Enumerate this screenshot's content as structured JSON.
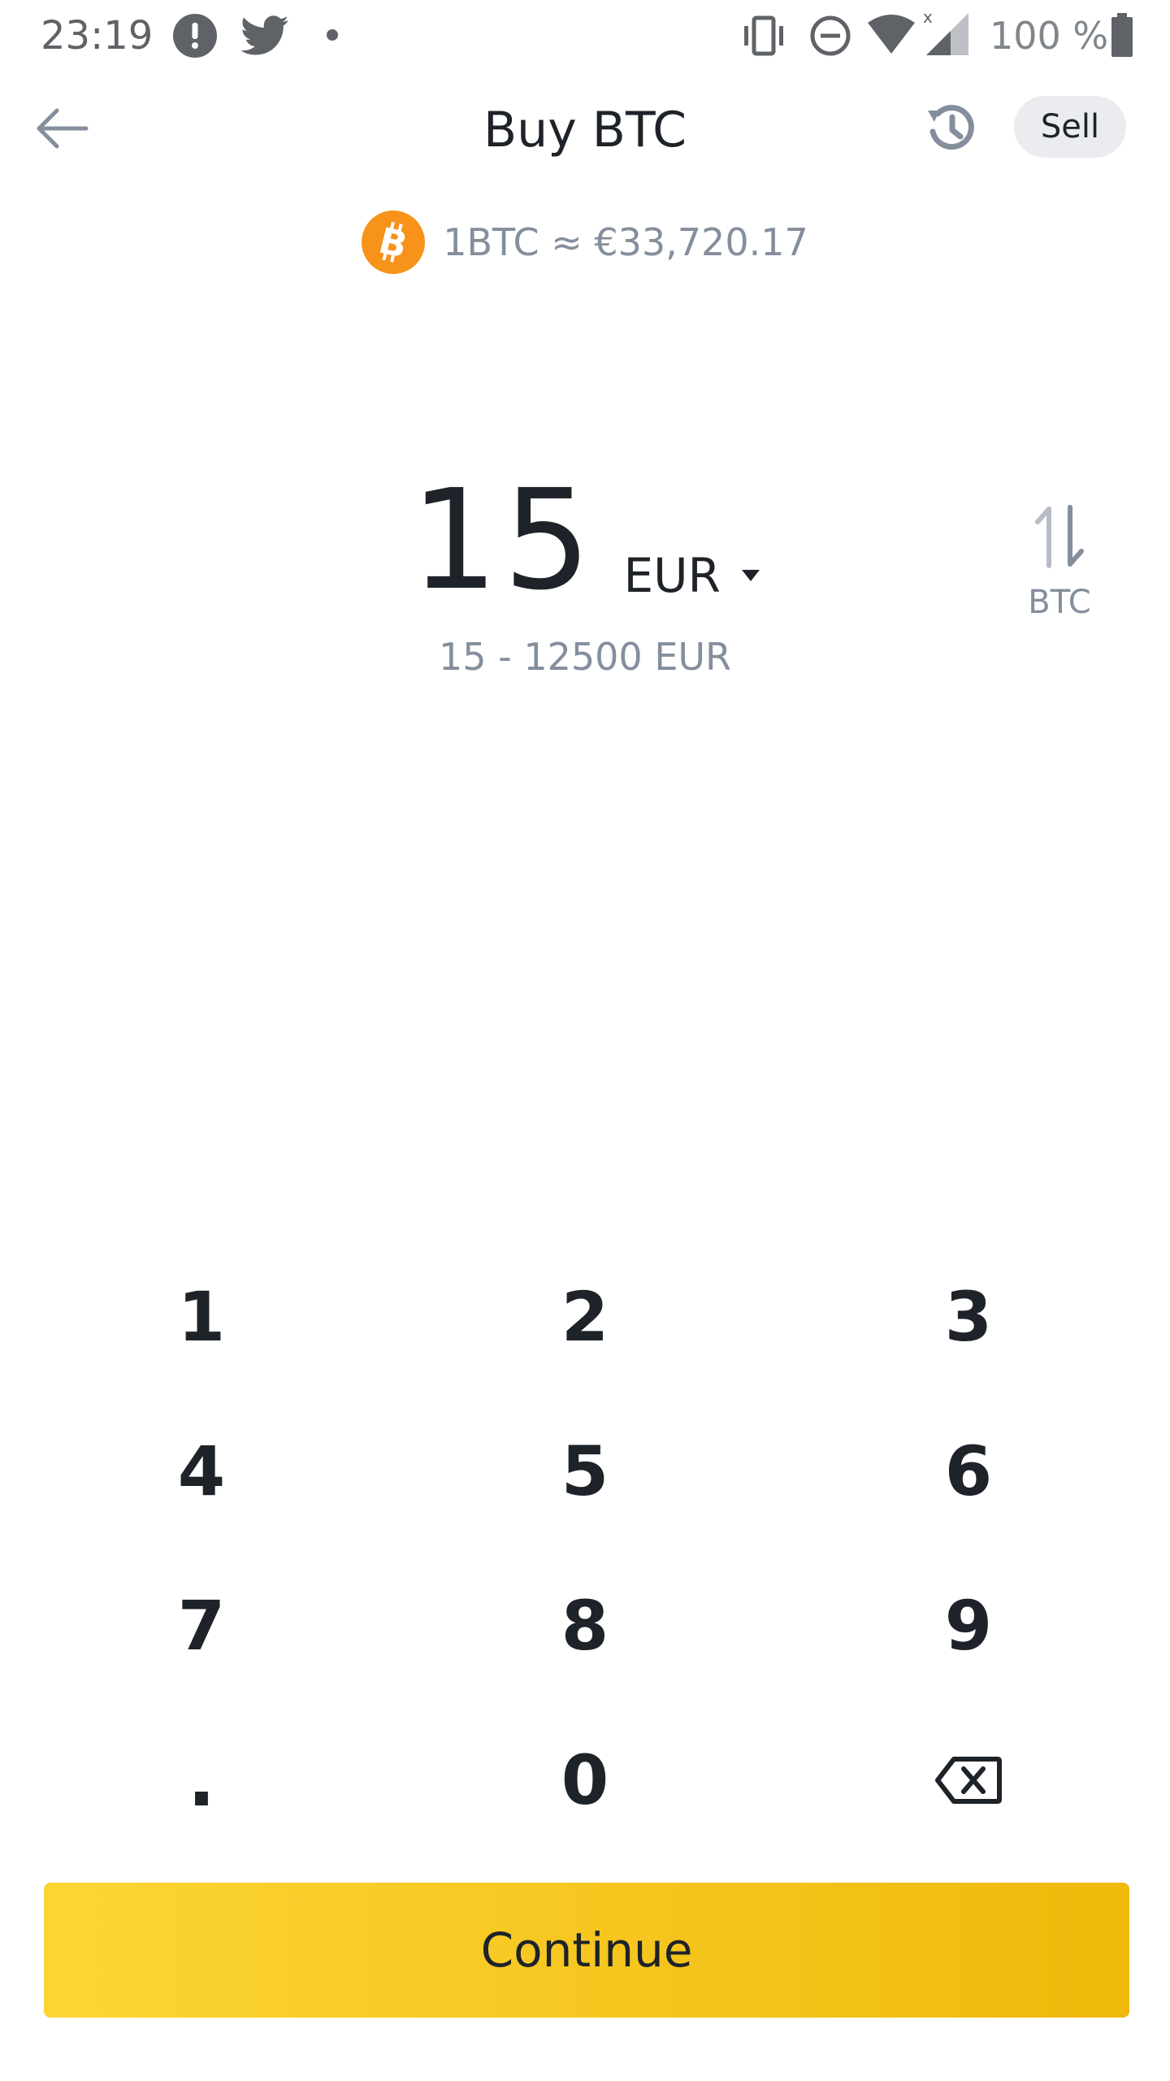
{
  "status_bar": {
    "time": "23:19",
    "battery_text": "100 %",
    "icons": [
      "alert-icon",
      "twitter-icon",
      "dot-icon",
      "vibrate-icon",
      "dnd-icon",
      "wifi-icon",
      "signal-icon",
      "battery-icon"
    ]
  },
  "header": {
    "title": "Buy BTC",
    "sell_label": "Sell"
  },
  "rate": {
    "text": "1BTC ≈ €33,720.17",
    "coin_icon": "bitcoin-icon",
    "coin_color": "#f7931a"
  },
  "amount": {
    "value": "15",
    "currency": "EUR",
    "range": "15 - 12500 EUR",
    "switch_label": "BTC"
  },
  "keypad": {
    "keys": [
      "1",
      "2",
      "3",
      "4",
      "5",
      "6",
      "7",
      "8",
      "9",
      ".",
      "0"
    ],
    "delete_icon": "backspace-icon"
  },
  "continue_label": "Continue",
  "colors": {
    "primary": "#fcd535",
    "primary_end": "#f0b90b",
    "text": "#1e2329",
    "muted": "#848e9c"
  }
}
